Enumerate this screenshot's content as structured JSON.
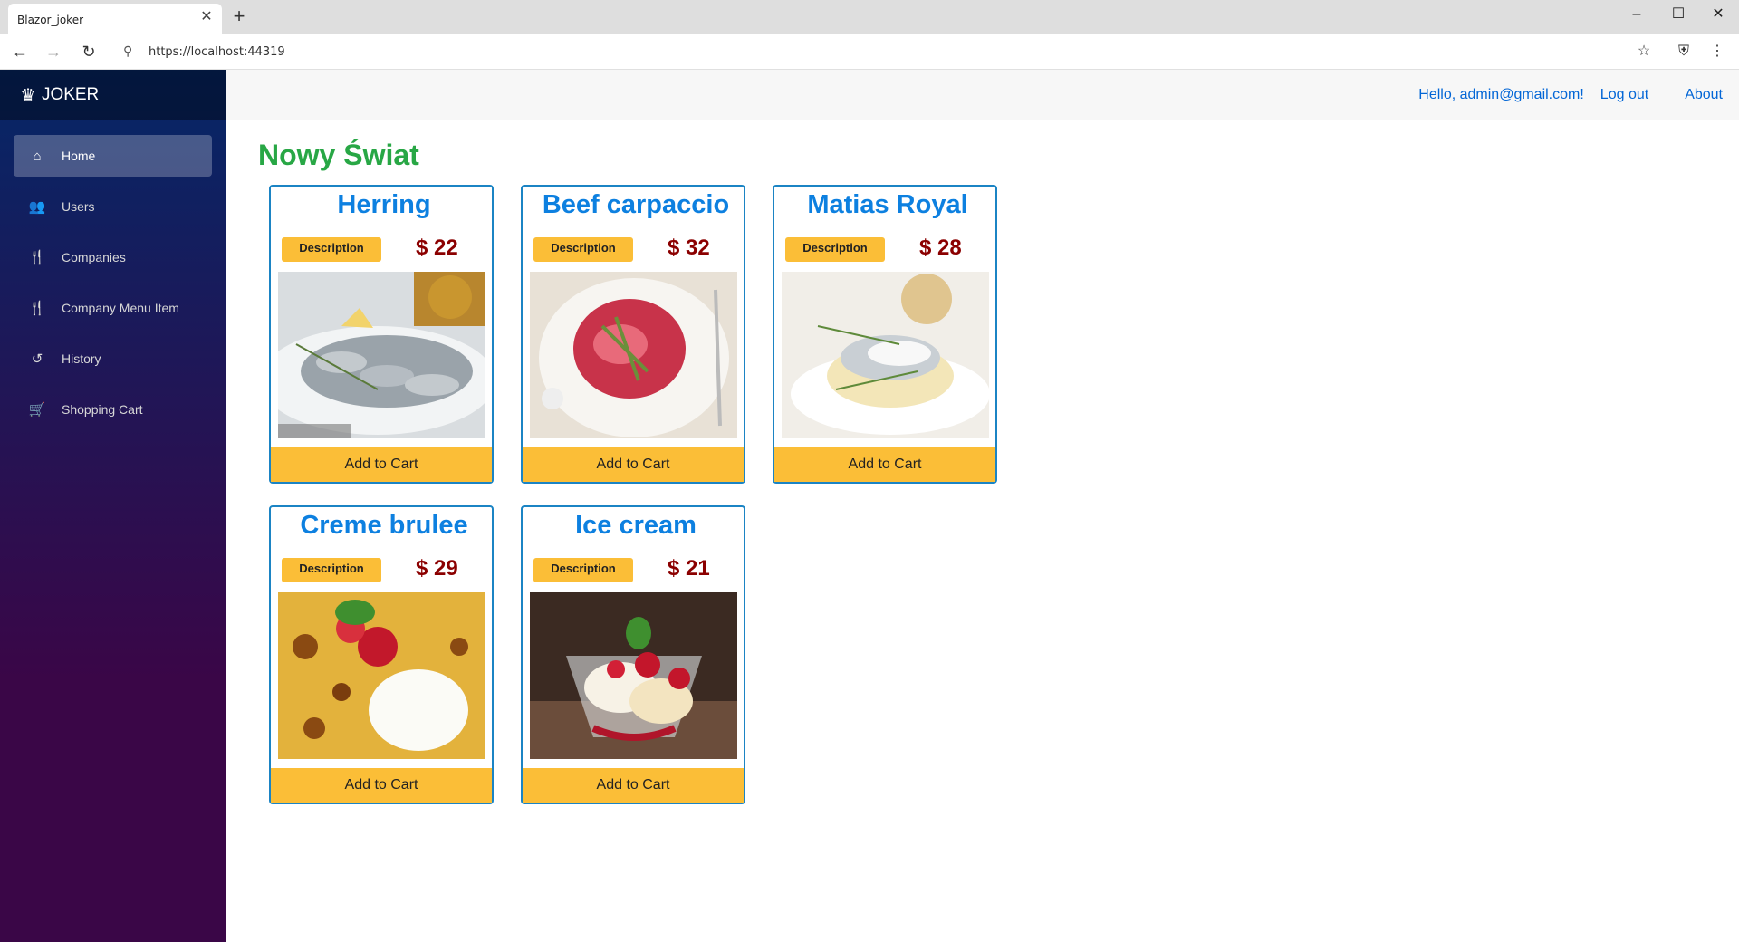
{
  "browser": {
    "tab_title": "Blazor_joker",
    "url": "https://localhost:44319"
  },
  "sidebar": {
    "brand": "JOKER",
    "items": [
      {
        "label": "Home",
        "icon": "home-icon",
        "active": true
      },
      {
        "label": "Users",
        "icon": "users-icon",
        "active": false
      },
      {
        "label": "Companies",
        "icon": "utensils-icon",
        "active": false
      },
      {
        "label": "Company Menu Item",
        "icon": "utensils-icon",
        "active": false
      },
      {
        "label": "History",
        "icon": "history-icon",
        "active": false
      },
      {
        "label": "Shopping Cart",
        "icon": "cart-icon",
        "active": false
      }
    ]
  },
  "topbar": {
    "greeting": "Hello, admin@gmail.com!",
    "logout": "Log out",
    "about": "About"
  },
  "page": {
    "title": "Nowy Świat"
  },
  "products": [
    {
      "name": "Herring",
      "price": "$ 22",
      "description_label": "Description",
      "add_label": "Add to Cart"
    },
    {
      "name": "Beef carpaccio",
      "price": "$ 32",
      "description_label": "Description",
      "add_label": "Add to Cart"
    },
    {
      "name": "Matias Royal",
      "price": "$ 28",
      "description_label": "Description",
      "add_label": "Add to Cart"
    },
    {
      "name": "Creme brulee",
      "price": "$ 29",
      "description_label": "Description",
      "add_label": "Add to Cart"
    },
    {
      "name": "Ice cream",
      "price": "$ 21",
      "description_label": "Description",
      "add_label": "Add to Cart"
    }
  ],
  "colors": {
    "title_green": "#28a745",
    "card_border": "#1b84c4",
    "accent_yellow": "#fbbe37",
    "price_red": "#8b0000",
    "link_blue": "#0366d6"
  }
}
